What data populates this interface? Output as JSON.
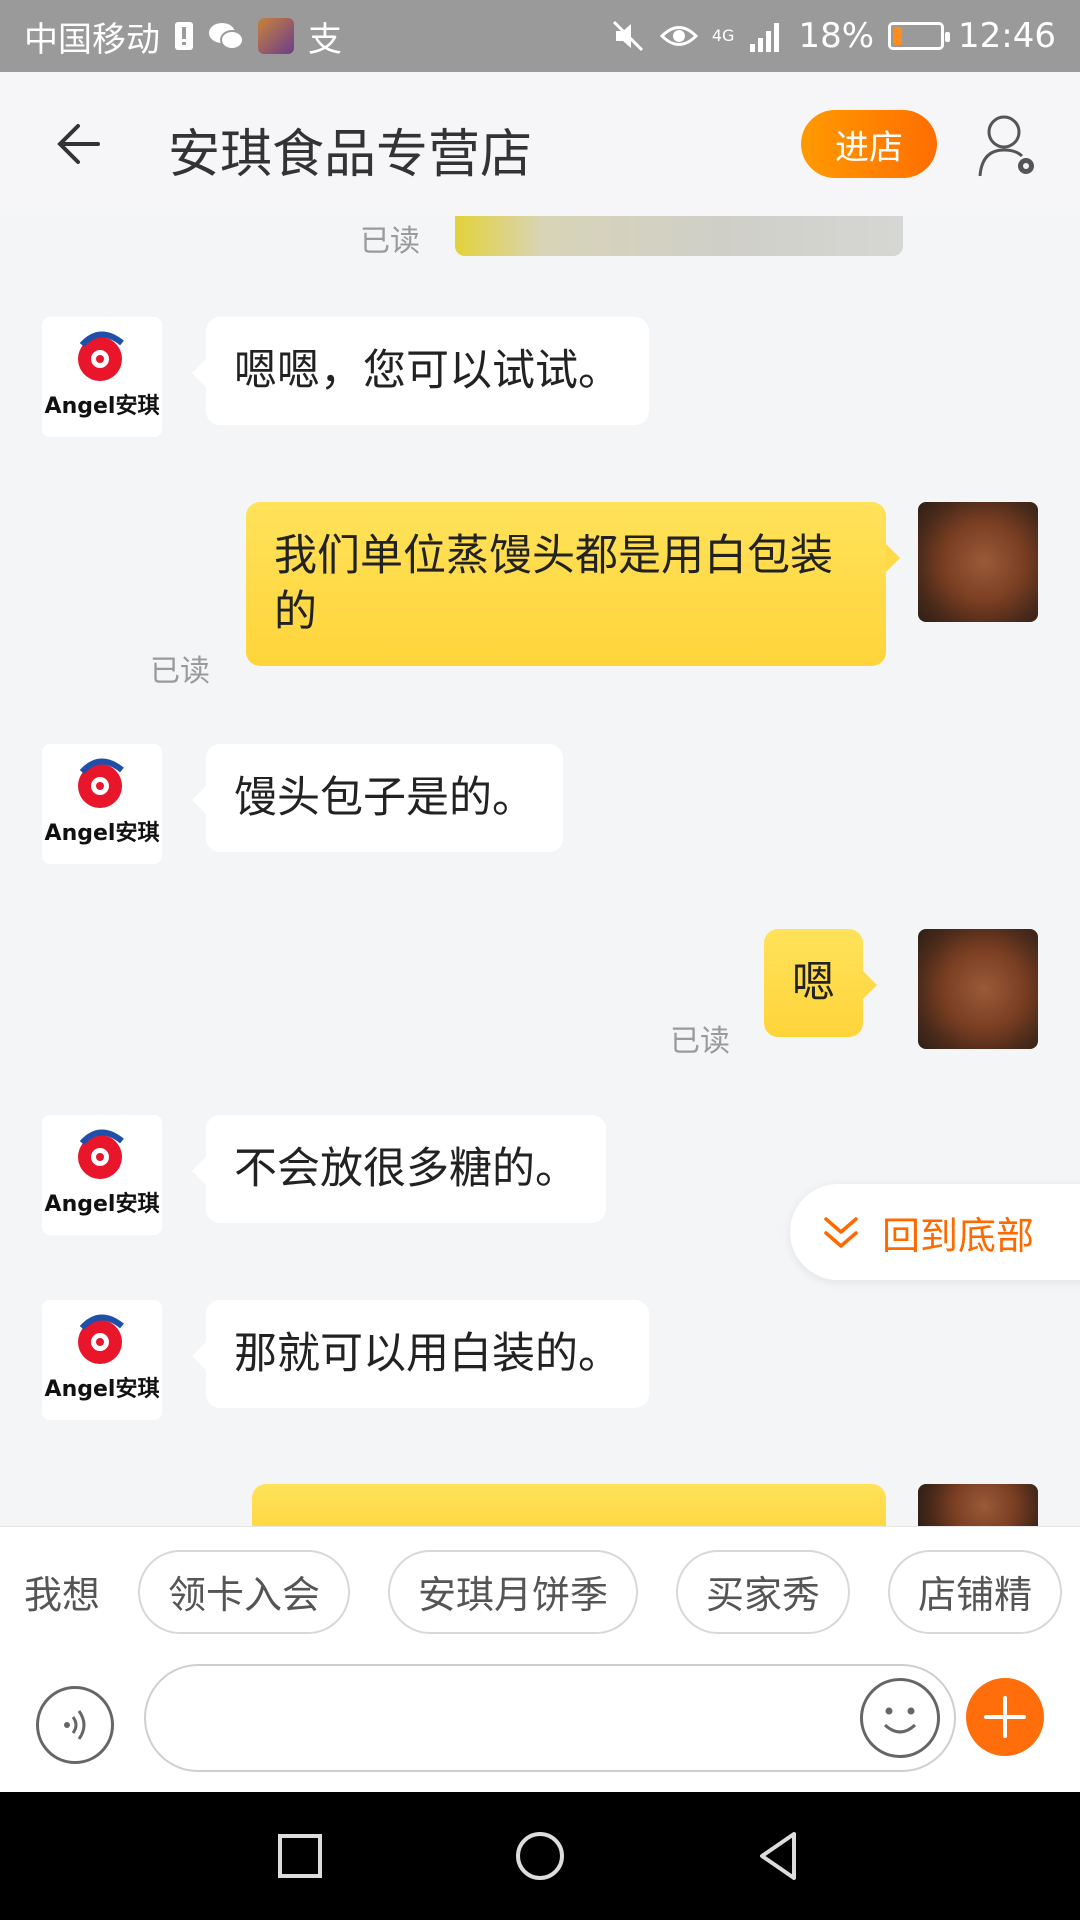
{
  "status_bar": {
    "carrier": "中国移动",
    "alipay_glyph": "支",
    "signal": "4G",
    "battery": "18%",
    "time": "12:46",
    "battery_level": 0.18
  },
  "header": {
    "title": "安琪食品专营店",
    "enter_store": "进店"
  },
  "chat": {
    "read_label": "已读",
    "messages": [
      {
        "side": "left",
        "text": "嗯嗯，您可以试试。"
      },
      {
        "side": "right",
        "text": "我们单位蒸馒头都是用白包装的",
        "status": "已读"
      },
      {
        "side": "left",
        "text": "馒头包子是的。"
      },
      {
        "side": "right",
        "text": "嗯",
        "status": "已读"
      },
      {
        "side": "left",
        "text": "不会放很多糖的。"
      },
      {
        "side": "left",
        "text": "那就可以用白装的。"
      }
    ],
    "scroll_to_bottom": "回到底部"
  },
  "quick_replies": {
    "label": "我想",
    "chips": [
      "领卡入会",
      "安琪月饼季",
      "买家秀",
      "店铺精"
    ]
  },
  "colors": {
    "accent_orange": "#ff6e00",
    "bubble_yellow": "#ffd94a",
    "angel_red": "#e8152b",
    "angel_blue": "#1f4fa8"
  },
  "icons": [
    "back-arrow-icon",
    "user-settings-icon",
    "voice-icon",
    "emoji-icon",
    "plus-icon",
    "double-chevron-down-icon",
    "nav-square-icon",
    "nav-home-icon",
    "nav-back-icon"
  ],
  "brand": {
    "logo_text_en": "Angel",
    "logo_text_cn": "安琪"
  }
}
